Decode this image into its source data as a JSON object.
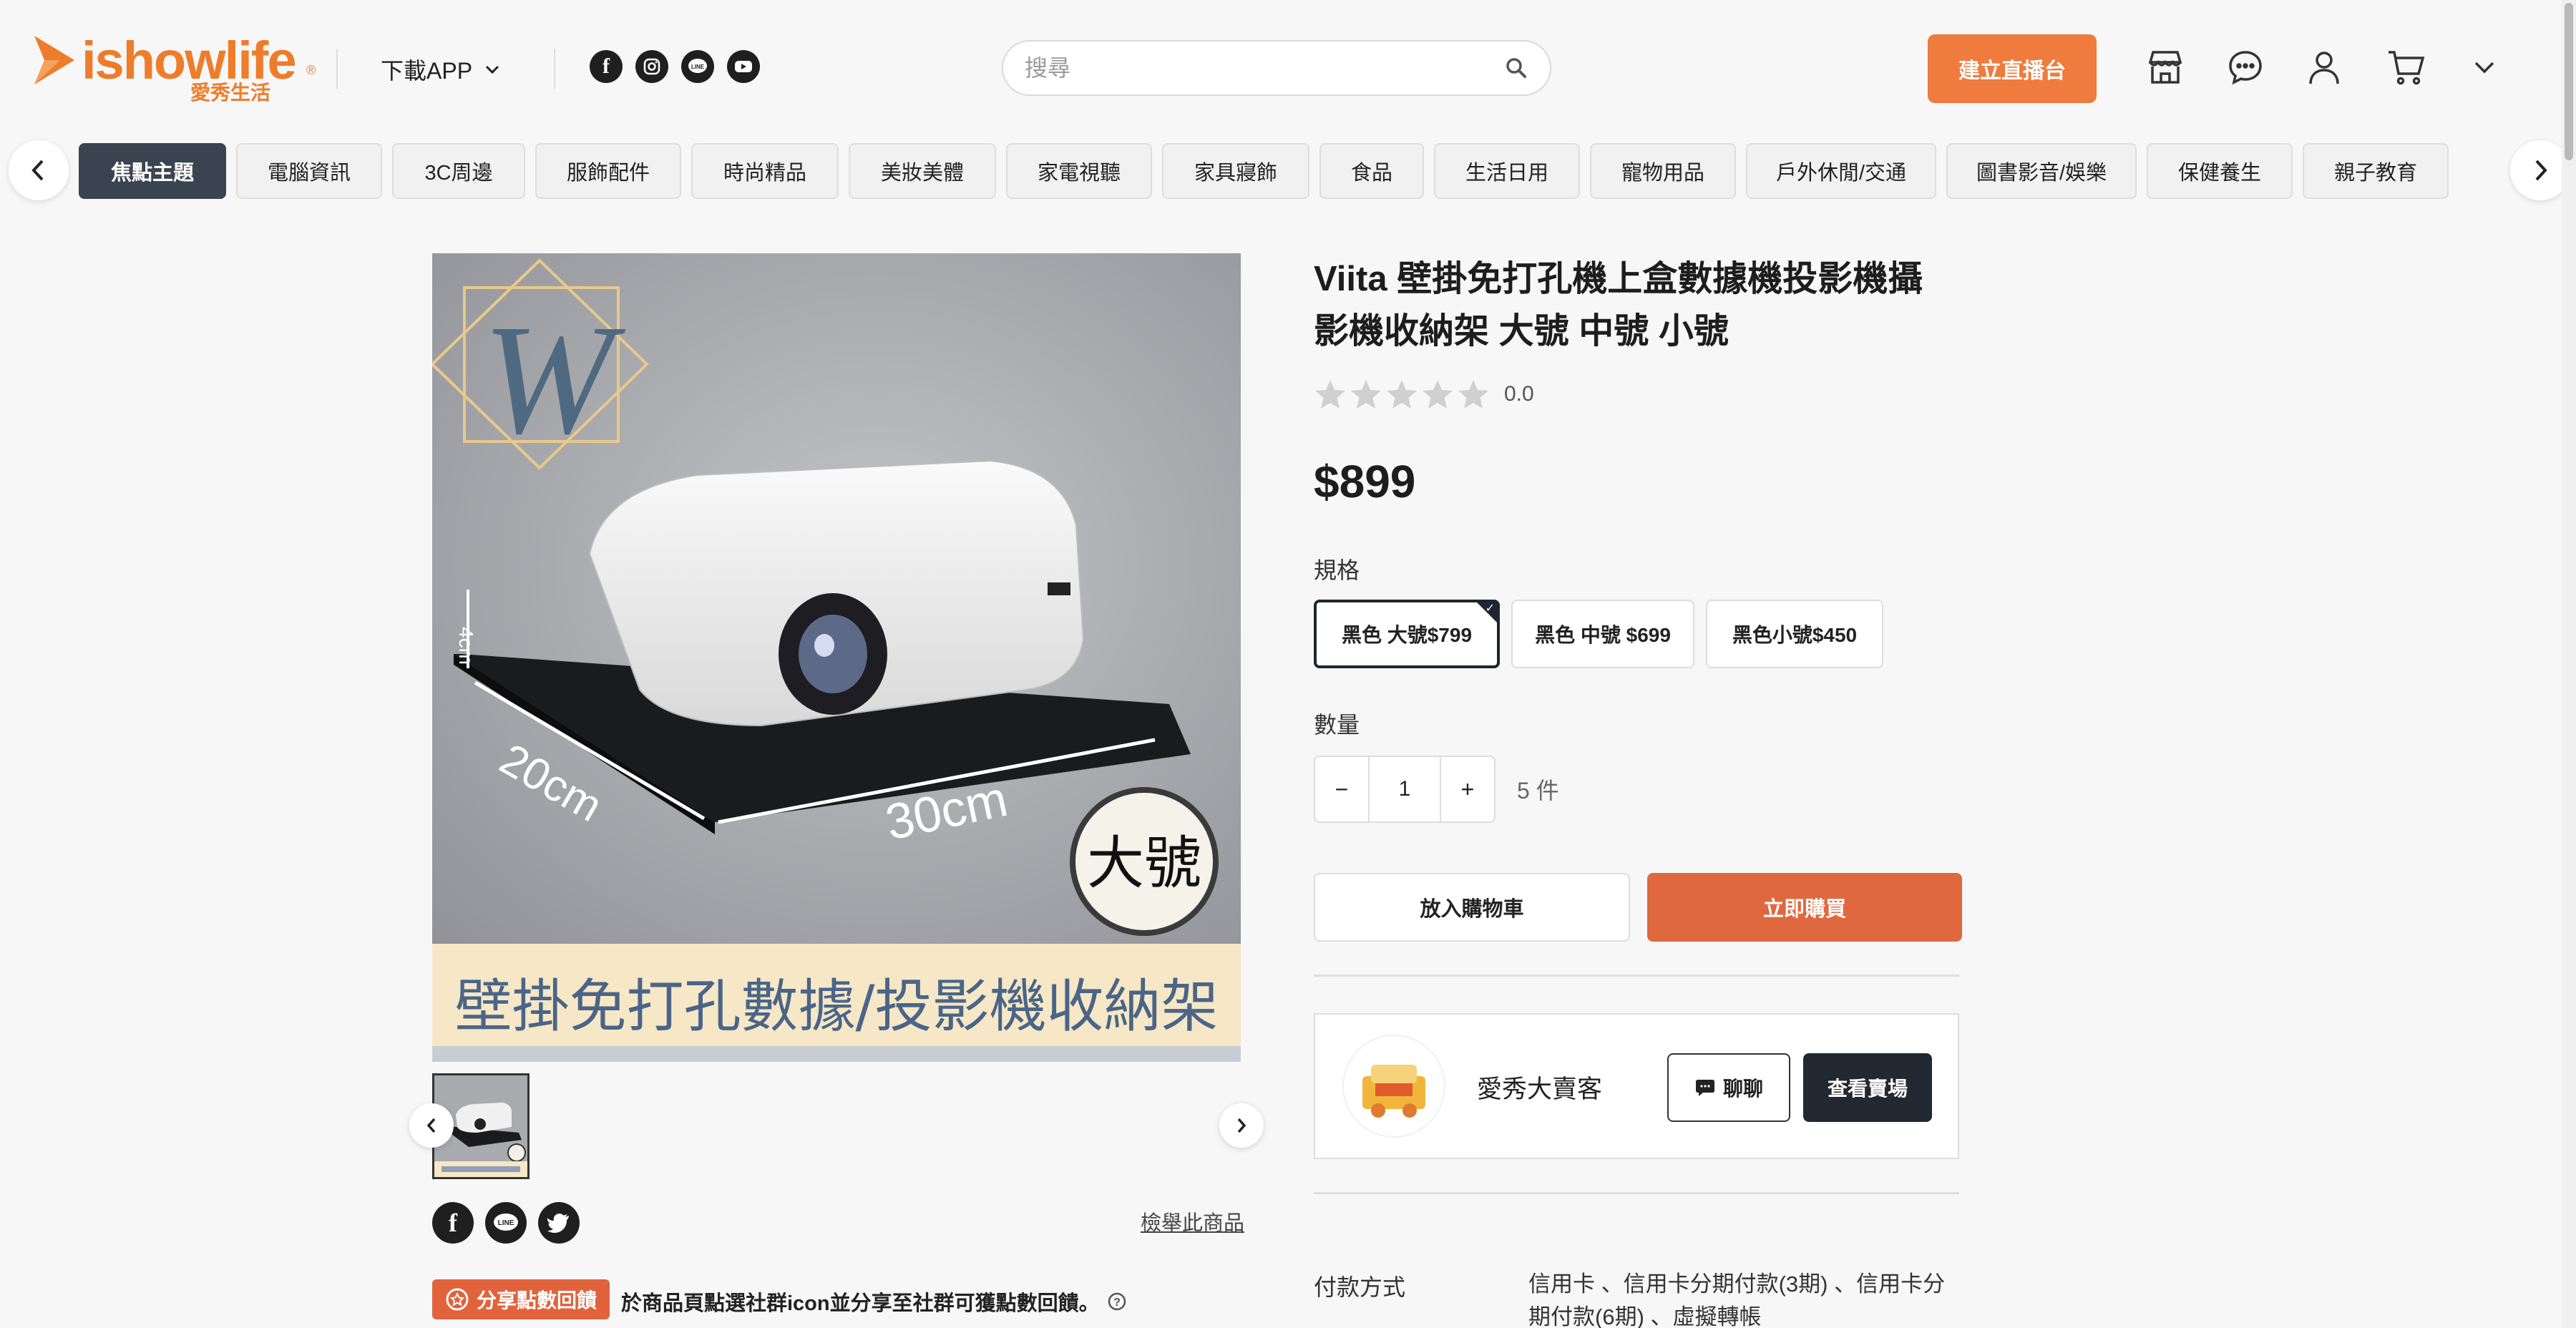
{
  "header": {
    "logo_text": "ishowlife",
    "logo_sub": "愛秀生活",
    "logo_reg": "®",
    "download_label": "下載APP",
    "social": [
      {
        "icon": "facebook-icon",
        "glyph": "f"
      },
      {
        "icon": "instagram-icon",
        "glyph": "◎"
      },
      {
        "icon": "line-icon",
        "glyph": "LINE"
      },
      {
        "icon": "youtube-icon",
        "glyph": "▶"
      }
    ],
    "search_placeholder": "搜尋",
    "live_button": "建立直播台",
    "icons": [
      "store-icon",
      "chat-bubble-icon",
      "user-icon",
      "cart-icon",
      "chevron-down-icon"
    ]
  },
  "categories": [
    {
      "label": "焦點主題",
      "active": true
    },
    {
      "label": "電腦資訊"
    },
    {
      "label": "3C周邊"
    },
    {
      "label": "服飾配件"
    },
    {
      "label": "時尚精品"
    },
    {
      "label": "美妝美體"
    },
    {
      "label": "家電視聽"
    },
    {
      "label": "家具寢飾"
    },
    {
      "label": "食品"
    },
    {
      "label": "生活日用"
    },
    {
      "label": "寵物用品"
    },
    {
      "label": "戶外休閒/交通"
    },
    {
      "label": "圖書影音/娛樂"
    },
    {
      "label": "保健養生"
    },
    {
      "label": "親子教育"
    }
  ],
  "gallery": {
    "image_text": {
      "size_badge": "大號",
      "dim_height": "4cm",
      "dim_depth": "20cm",
      "dim_width": "30cm",
      "banner": "壁掛免打孔數據/投影機收納架"
    },
    "report_link": "檢舉此商品",
    "share_icons": [
      "facebook-icon",
      "line-icon",
      "twitter-icon"
    ],
    "reward_badge": "分享點數回饋",
    "reward_text": "於商品頁點選社群icon並分享至社群可獲點數回饋。"
  },
  "product": {
    "title": "Viita 壁掛免打孔機上盒數據機投影機攝影機收納架 大號 中號 小號",
    "rating": "0.0",
    "price": "$899",
    "spec_label": "規格",
    "options": [
      {
        "label": "黑色 大號$799",
        "selected": true
      },
      {
        "label": "黑色 中號 $699"
      },
      {
        "label": "黑色小號$450"
      }
    ],
    "qty_label": "數量",
    "qty_minus": "−",
    "qty_value": "1",
    "qty_plus": "+",
    "qty_stock": "5 件",
    "add_to_cart": "放入購物車",
    "buy_now": "立即購買"
  },
  "seller": {
    "name": "愛秀大賣客",
    "chat_button": "聊聊",
    "store_button": "查看賣場"
  },
  "payment": {
    "label": "付款方式",
    "value": "信用卡 、信用卡分期付款(3期) 、信用卡分期付款(6期) 、虛擬轉帳"
  },
  "colors": {
    "brand_orange": "#ee7d2b",
    "buy_orange": "#e0683f",
    "dark": "#3a4350"
  }
}
